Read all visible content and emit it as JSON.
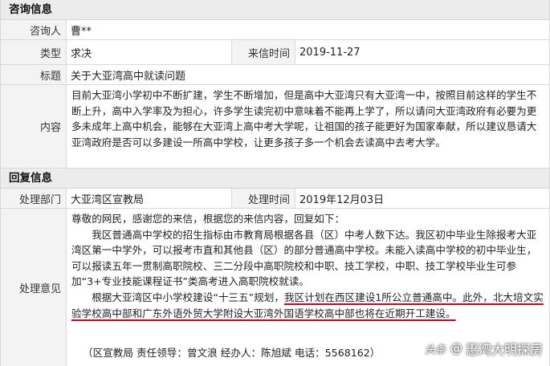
{
  "consult": {
    "section_title": "咨询信息",
    "consultant_label": "咨询人",
    "consultant_value": "曹**",
    "type_label": "类型",
    "type_value": "求决",
    "date_label": "来信时间",
    "date_value": "2019-11-27",
    "subject_label": "标题",
    "subject_value": "关于大亚湾高中就读问题",
    "content_label": "内容",
    "content_text": "目前大亚湾小学初中不断扩建，学生不断增加，但是高中大亚湾只有大亚湾一中，按照目前这样的学生不断上升，高中入学率及为担心，许多学生读完初中意味着不能再上学了，所以请问大亚湾政府有必要为更多未成年上高中机会，能够在大亚湾上高中考大学呢，让祖国的孩子能更好为国家奉献，所以建议恳请大亚湾政府是否可以多建设一所高中学校，让更多孩子多一个机会去读高中去考大学。"
  },
  "reply": {
    "section_title": "回复信息",
    "dept_label": "处理部门",
    "dept_value": "大亚湾区宣教局",
    "time_label": "处理时间",
    "time_value": "2019年12月03日",
    "opinion_label": "处理意见",
    "greeting": "尊敬的网民，感谢您的来信，根据您的来信内容，回复如下：",
    "para1": "我区普通高中学校的招生指标由市教育局根据各县（区）中考人数下达。我区初中毕业生除报考大亚湾区第一中学外，可以报考市直和其他县（区）的部分普通高中学校。未能入读高中学校的初中毕业生，可以报读五年一贯制高职院校、三二分段中高职院校和中职、技工学校，中职、技工学校毕业生可参加“3+专业技能课程证书”类高考进入高职院校就读。",
    "para2_plain": "根据大亚湾区中小学校建设“十三五”规划，",
    "para2_underlined": "我区计划在西区建设1所公立普通高中。此外，北大培文实验学校高中部和广东外语外贸大学附设大亚湾外国语学校高中部也将在近期开工建设。",
    "credit": "（区宣教局 责任领导：曾文浪 经办人：陈旭斌 电话：5568162）"
  },
  "watermark": {
    "platform": "头条",
    "at": "@",
    "account": "惠湾大明探房"
  },
  "colors": {
    "underline": "#d0021b",
    "label_bg": "#f3f3f3",
    "header_bg": "#ececec"
  }
}
